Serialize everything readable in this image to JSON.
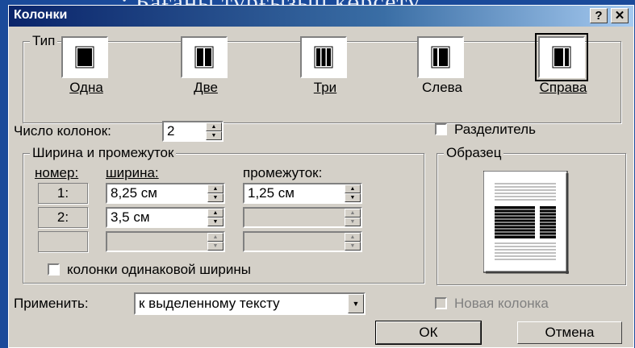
{
  "background": {
    "heading_text": ": Бағаны тұрғызып көрсету",
    "color": "#1a4a9a"
  },
  "dialog": {
    "title": "Колонки",
    "help_label": "?",
    "close_label": "✕"
  },
  "type_group": {
    "label": "Тип",
    "options": [
      {
        "label": "Одна",
        "icon": "one-column-icon"
      },
      {
        "label": "Две",
        "icon": "two-columns-icon"
      },
      {
        "label": "Три",
        "icon": "three-columns-icon"
      },
      {
        "label": "Слева",
        "icon": "left-column-icon"
      },
      {
        "label": "Справа",
        "icon": "right-column-icon",
        "selected": true
      }
    ]
  },
  "column_count": {
    "label": "Число колонок:",
    "value": "2"
  },
  "separator": {
    "label": "Разделитель",
    "checked": false
  },
  "width_group": {
    "label": "Ширина и промежуток",
    "col_number": "номер:",
    "col_width": "ширина:",
    "col_gap": "промежуток:",
    "rows": [
      {
        "number": "1:",
        "width": "8,25 см",
        "gap": "1,25 см"
      },
      {
        "number": "2:",
        "width": "3,5 см",
        "gap": ""
      },
      {
        "number": "",
        "width": "",
        "gap": ""
      }
    ],
    "equal_width_label": "колонки одинаковой ширины"
  },
  "preview_group": {
    "label": "Образец"
  },
  "apply": {
    "label": "Применить:",
    "value": "к выделенному тексту"
  },
  "new_column": {
    "label": "Новая колонка",
    "enabled": false
  },
  "buttons": {
    "ok": "ОК",
    "cancel": "Отмена"
  }
}
